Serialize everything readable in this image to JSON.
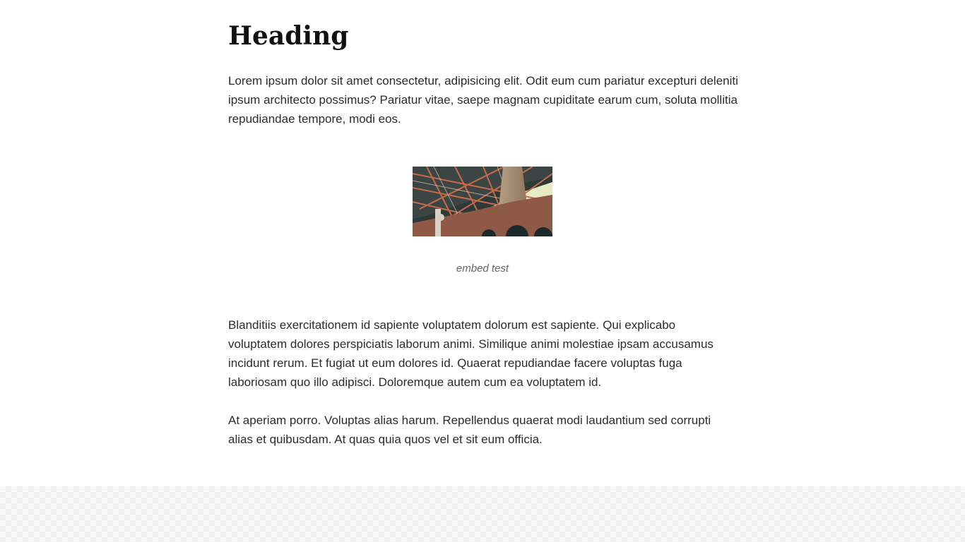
{
  "article": {
    "heading": "Heading",
    "paragraphs": [
      "Lorem ipsum dolor sit amet consectetur, adipisicing elit. Odit eum cum pariatur excepturi deleniti ipsum architecto possimus? Pariatur vitae, saepe magnam cupiditate earum cum, soluta mollitia repudiandae tempore, modi eos.",
      "Blanditiis exercitationem id sapiente voluptatem dolorum est sapiente. Qui explicabo voluptatem dolores perspiciatis laborum animi. Similique animi molestiae ipsam accusamus incidunt rerum. Et fugiat ut eum dolores id. Quaerat repudiandae facere voluptas fuga laboriosam quo illo adipisci. Doloremque autem cum ea voluptatem id.",
      "At aperiam porro. Voluptas alias harum. Repellendus quaerat modi laudantium sed corrupti alias et quibusdam. At quas quia quos vel et sit eum officia."
    ],
    "figure": {
      "caption": "embed test"
    }
  }
}
